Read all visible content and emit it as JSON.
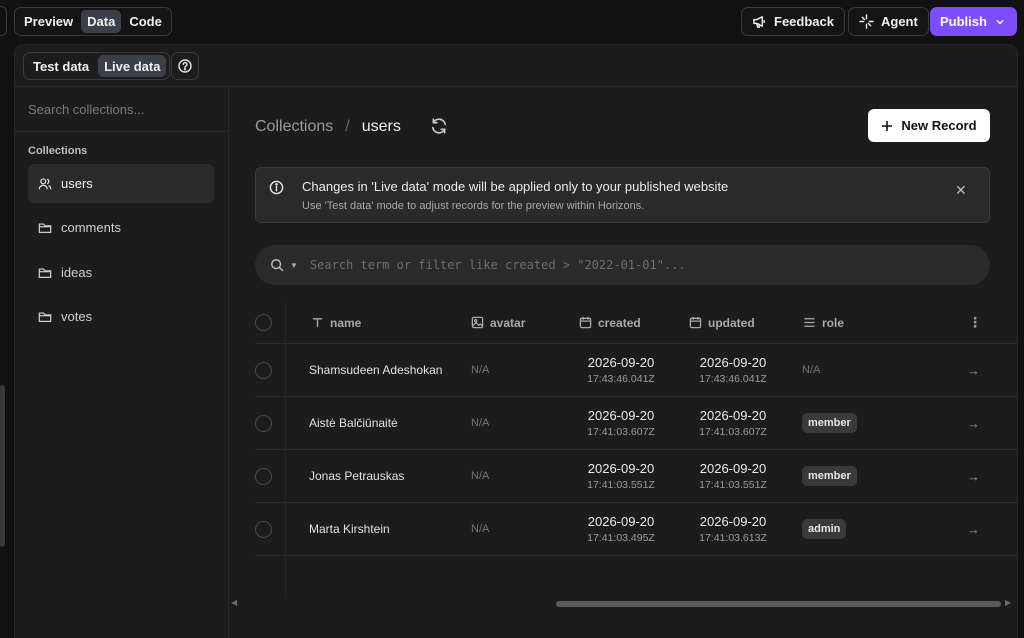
{
  "topbar": {
    "view_tabs": [
      "Preview",
      "Data",
      "Code"
    ],
    "active_view": "Data",
    "feedback_label": "Feedback",
    "agent_label": "Agent",
    "publish_label": "Publish"
  },
  "modebar": {
    "modes": [
      "Test data",
      "Live data"
    ],
    "active_mode": "Live data"
  },
  "sidebar": {
    "search_placeholder": "Search collections...",
    "heading": "Collections",
    "items": [
      {
        "label": "users",
        "icon": "users-icon",
        "active": true
      },
      {
        "label": "comments",
        "icon": "folder-icon",
        "active": false
      },
      {
        "label": "ideas",
        "icon": "folder-icon",
        "active": false
      },
      {
        "label": "votes",
        "icon": "folder-icon",
        "active": false
      }
    ]
  },
  "breadcrumb": {
    "root": "Collections",
    "separator": "/",
    "current": "users"
  },
  "new_record_label": "New Record",
  "alert": {
    "title": "Changes in 'Live data' mode will be applied only to your published website",
    "subtitle": "Use 'Test data' mode to adjust records for the preview within Horizons."
  },
  "filter": {
    "placeholder": "Search term or filter like created > \"2022-01-01\"..."
  },
  "table": {
    "columns": [
      {
        "label": "name",
        "icon": "text-type-icon"
      },
      {
        "label": "avatar",
        "icon": "image-icon"
      },
      {
        "label": "created",
        "icon": "calendar-icon"
      },
      {
        "label": "updated",
        "icon": "calendar-icon"
      },
      {
        "label": "role",
        "icon": "list-icon"
      }
    ],
    "rows": [
      {
        "name": "Shamsudeen Adeshokan",
        "avatar": "N/A",
        "created_date": "2026-09-20",
        "created_time": "17:43:46.041Z",
        "updated_date": "2026-09-20",
        "updated_time": "17:43:46.041Z",
        "role": "N/A"
      },
      {
        "name": "Aistė Balčiūnaitė",
        "avatar": "N/A",
        "created_date": "2026-09-20",
        "created_time": "17:41:03.607Z",
        "updated_date": "2026-09-20",
        "updated_time": "17:41:03.607Z",
        "role": "member"
      },
      {
        "name": "Jonas Petrauskas",
        "avatar": "N/A",
        "created_date": "2026-09-20",
        "created_time": "17:41:03.551Z",
        "updated_date": "2026-09-20",
        "updated_time": "17:41:03.551Z",
        "role": "member"
      },
      {
        "name": "Marta Kirshtein",
        "avatar": "N/A",
        "created_date": "2026-09-20",
        "created_time": "17:41:03.495Z",
        "updated_date": "2026-09-20",
        "updated_time": "17:41:03.613Z",
        "role": "admin"
      }
    ]
  },
  "colors": {
    "accent": "#7c4dff",
    "background": "#111111",
    "panel": "#1c1c1c"
  }
}
